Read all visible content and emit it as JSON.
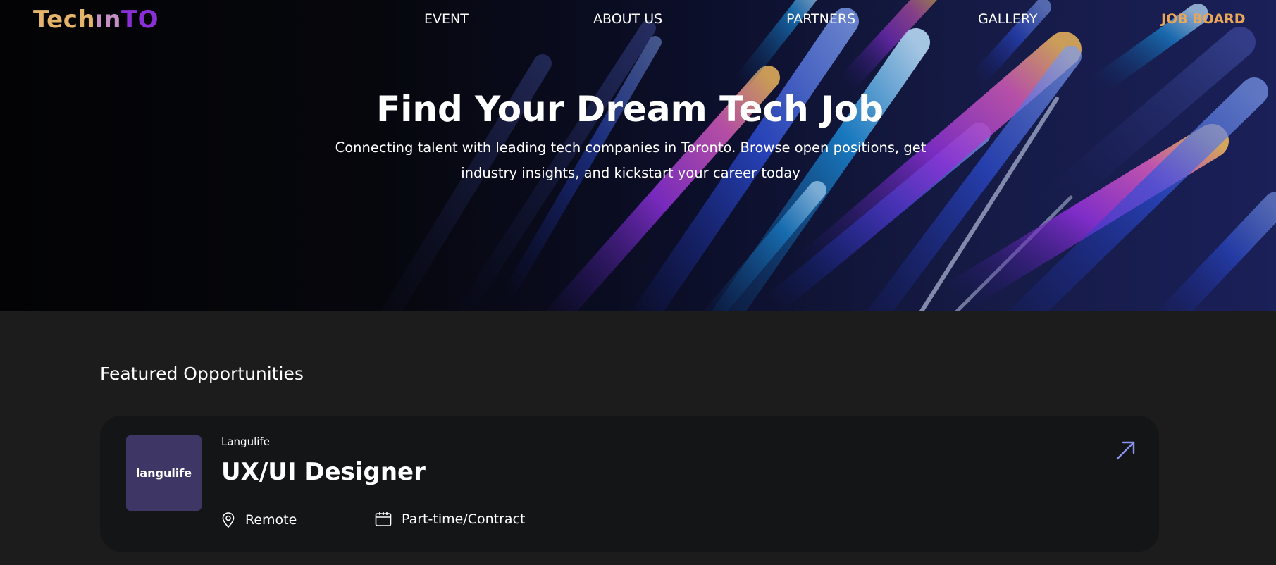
{
  "brand": {
    "logo_tech": "Tech",
    "logo_in": "ın",
    "logo_to": "TO"
  },
  "nav": {
    "items": [
      {
        "label": "EVENT"
      },
      {
        "label": "ABOUT US"
      },
      {
        "label": "PARTNERS"
      },
      {
        "label": "GALLERY"
      },
      {
        "label": "JOB BOARD",
        "active": true
      }
    ]
  },
  "hero": {
    "title": "Find Your Dream Tech Job",
    "subtitle": "Connecting talent with leading tech companies in Toronto. Browse open positions, get industry insights, and kickstart your career today"
  },
  "featured": {
    "title": "Featured Opportunities",
    "jobs": [
      {
        "company": "Langulife",
        "logo_text": "langulife",
        "title": "UX/UI Designer",
        "location": "Remote",
        "type": "Part-time/Contract"
      }
    ]
  },
  "icons": {
    "location": "map-pin-icon",
    "type": "calendar-icon",
    "open": "arrow-up-right-icon"
  },
  "colors": {
    "accent_gold": "#e9a55a",
    "logo_purple": "#8a2fd6",
    "card_bg": "#141517",
    "page_bg": "#1c1c1d",
    "arrow": "#8b95f0"
  }
}
